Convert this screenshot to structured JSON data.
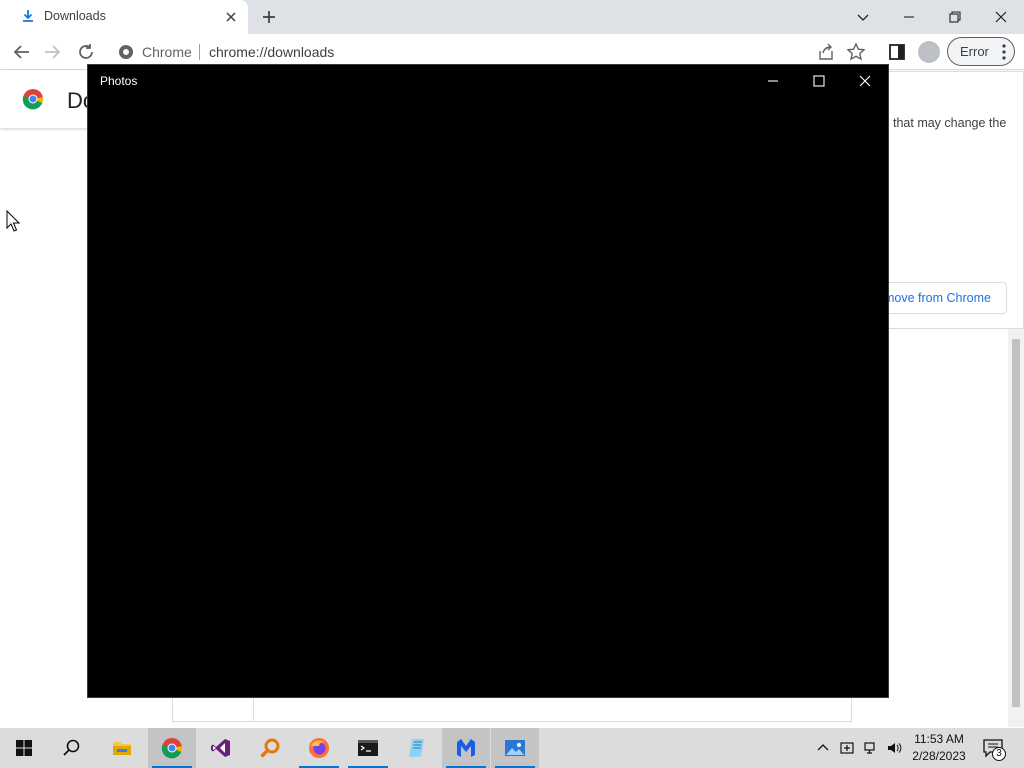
{
  "browser": {
    "tab": {
      "title": "Downloads",
      "icon": "download-icon"
    },
    "toolbar": {
      "site_label": "Chrome",
      "url": "chrome://downloads",
      "profile_error_label": "Error"
    }
  },
  "downloads_page": {
    "title_partial": "Do",
    "card_text_partial": "that may change the",
    "remove_button_partial": "move from Chrome"
  },
  "photos_window": {
    "title": "Photos"
  },
  "taskbar": {
    "apps": [
      "start",
      "search",
      "file-explorer",
      "chrome",
      "visual-studio",
      "search-app",
      "firefox",
      "terminal",
      "paper-app",
      "malwarebytes",
      "photos"
    ],
    "clock": {
      "time": "11:53 AM",
      "date": "2/28/2023"
    },
    "notification_count": "3"
  },
  "colors": {
    "accent": "#0078d7",
    "chrome_blue": "#1a73e8",
    "photos_bg": "#000000"
  }
}
